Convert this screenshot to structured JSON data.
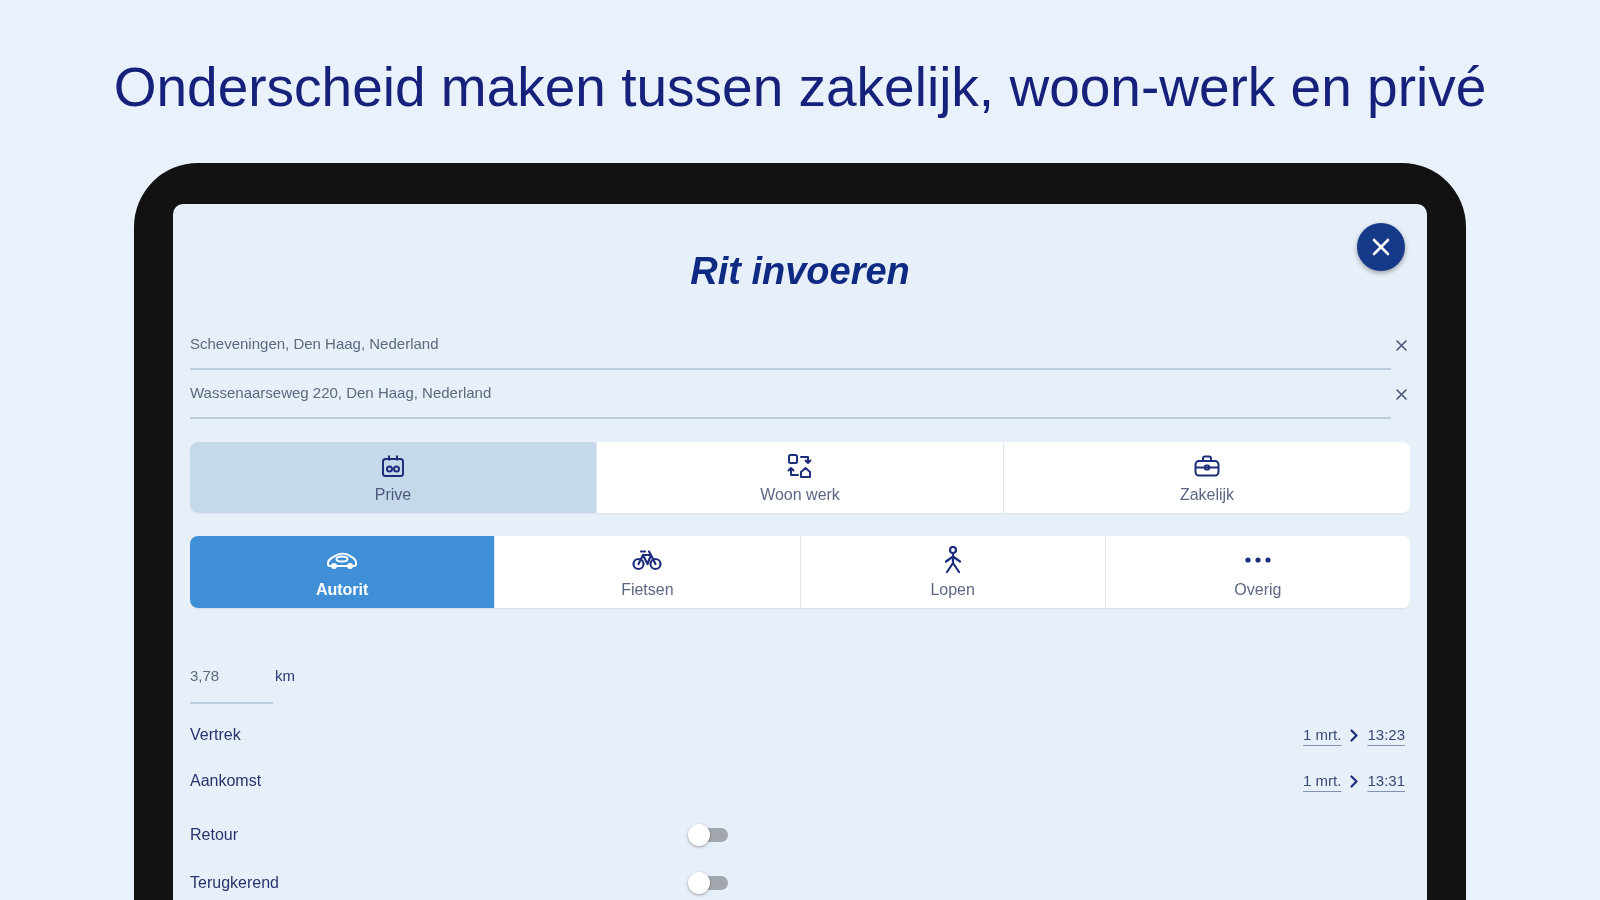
{
  "headline": "Onderscheid maken tussen zakelijk, woon-werk en privé",
  "dialog": {
    "title": "Rit invoeren"
  },
  "address_fields": [
    {
      "value": "Scheveningen, Den Haag, Nederland"
    },
    {
      "value": "Wassenaarseweg 220, Den Haag, Nederland"
    }
  ],
  "trip_types": [
    {
      "label": "Prive",
      "selected": true
    },
    {
      "label": "Woon werk",
      "selected": false
    },
    {
      "label": "Zakelijk",
      "selected": false
    }
  ],
  "transport_modes": [
    {
      "label": "Autorit",
      "selected": true
    },
    {
      "label": "Fietsen",
      "selected": false
    },
    {
      "label": "Lopen",
      "selected": false
    },
    {
      "label": "Overig",
      "selected": false
    }
  ],
  "distance": {
    "value": "3,78",
    "unit": "km"
  },
  "times": [
    {
      "label": "Vertrek",
      "date": "1 mrt.",
      "time": "13:23"
    },
    {
      "label": "Aankomst",
      "date": "1 mrt.",
      "time": "13:31"
    }
  ],
  "toggles": [
    {
      "label": "Retour",
      "on": false
    },
    {
      "label": "Terugkerend",
      "on": false
    }
  ]
}
